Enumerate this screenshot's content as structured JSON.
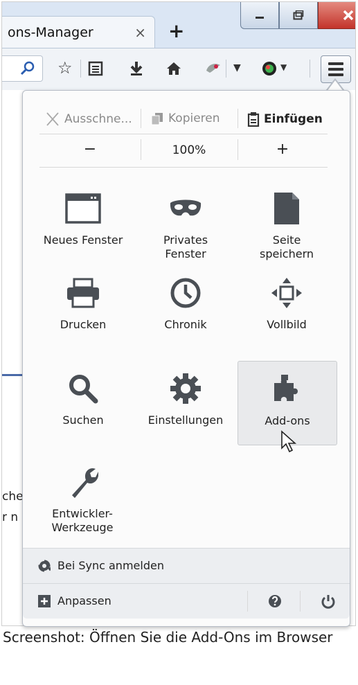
{
  "window": {
    "tab_title": "ons-Manager",
    "tab_close": "×",
    "new_tab": "+",
    "controls": [
      "minimize",
      "maximize",
      "close"
    ]
  },
  "toolbar": {
    "icons": [
      "search-icon",
      "star-icon",
      "reading-list-icon",
      "download-icon",
      "home-icon",
      "extension-icon",
      "dropdown-icon",
      "color-icon",
      "menu-icon"
    ]
  },
  "page": {
    "partial_text": [
      "che",
      "r n"
    ]
  },
  "menu": {
    "edit": {
      "cut": "Ausschne...",
      "copy": "Kopieren",
      "paste": "Einfügen"
    },
    "zoom": {
      "out": "−",
      "level": "100%",
      "in": "+"
    },
    "items": [
      {
        "label": "Neues Fenster",
        "icon": "window-icon"
      },
      {
        "label": "Privates Fenster",
        "icon": "mask-icon"
      },
      {
        "label": "Seite speichern",
        "icon": "page-icon"
      },
      {
        "label": "Drucken",
        "icon": "printer-icon"
      },
      {
        "label": "Chronik",
        "icon": "clock-icon"
      },
      {
        "label": "Vollbild",
        "icon": "fullscreen-icon"
      },
      {
        "label": "Suchen",
        "icon": "magnifier-icon"
      },
      {
        "label": "Einstellungen",
        "icon": "gear-icon"
      },
      {
        "label": "Add-ons",
        "icon": "puzzle-icon",
        "hovered": true
      },
      {
        "label": "Entwickler-Werkzeuge",
        "icon": "wrench-icon"
      }
    ],
    "sync_label": "Bei Sync anmelden",
    "customize_label": "Anpassen"
  },
  "caption": "Screenshot: Öffnen Sie die Add-Ons im Browser"
}
